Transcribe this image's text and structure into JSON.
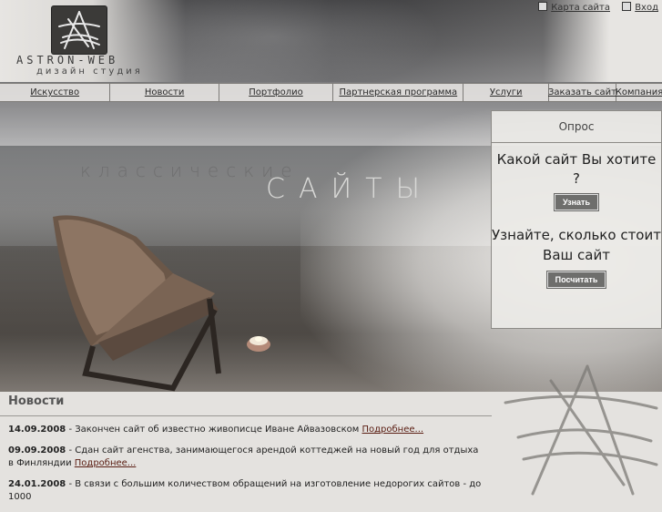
{
  "brand": {
    "name": "ASTRON-WEB",
    "tagline": "дизайн студия"
  },
  "top_links": {
    "sitemap": "Карта сайта",
    "login": "Вход"
  },
  "nav": {
    "items": [
      {
        "label": "Искусство"
      },
      {
        "label": "Новости"
      },
      {
        "label": "Портфолио"
      },
      {
        "label": "Партнерская программа"
      },
      {
        "label": "Услуги"
      },
      {
        "label": "Заказать сайт"
      },
      {
        "label": "Компания"
      }
    ]
  },
  "hero": {
    "line1": "классические",
    "line2": "САЙТЫ"
  },
  "poll": {
    "title": "Опрос",
    "question": "Какой сайт Вы хотите ?",
    "button": "Узнать",
    "cta": "Узнайте, сколько стоит Ваш сайт",
    "calc_button": "Посчитать"
  },
  "news": {
    "title": "Новости",
    "more": "Подробнее...",
    "items": [
      {
        "date": "14.09.2008",
        "text": " - Закончен сайт об известно живописце Иване Айвазовском "
      },
      {
        "date": "09.09.2008",
        "text": " - Сдан сайт агенства, занимающегося арендой коттеджей на новый год для отдыха в Финляндии "
      },
      {
        "date": "24.01.2008",
        "text": " - В связи с большим количеством обращений на изготовление недорогих сайтов - до 1000"
      }
    ]
  },
  "colors": {
    "link": "#5a1d12",
    "button": "#6e6e6c",
    "border": "#8c8a86"
  }
}
